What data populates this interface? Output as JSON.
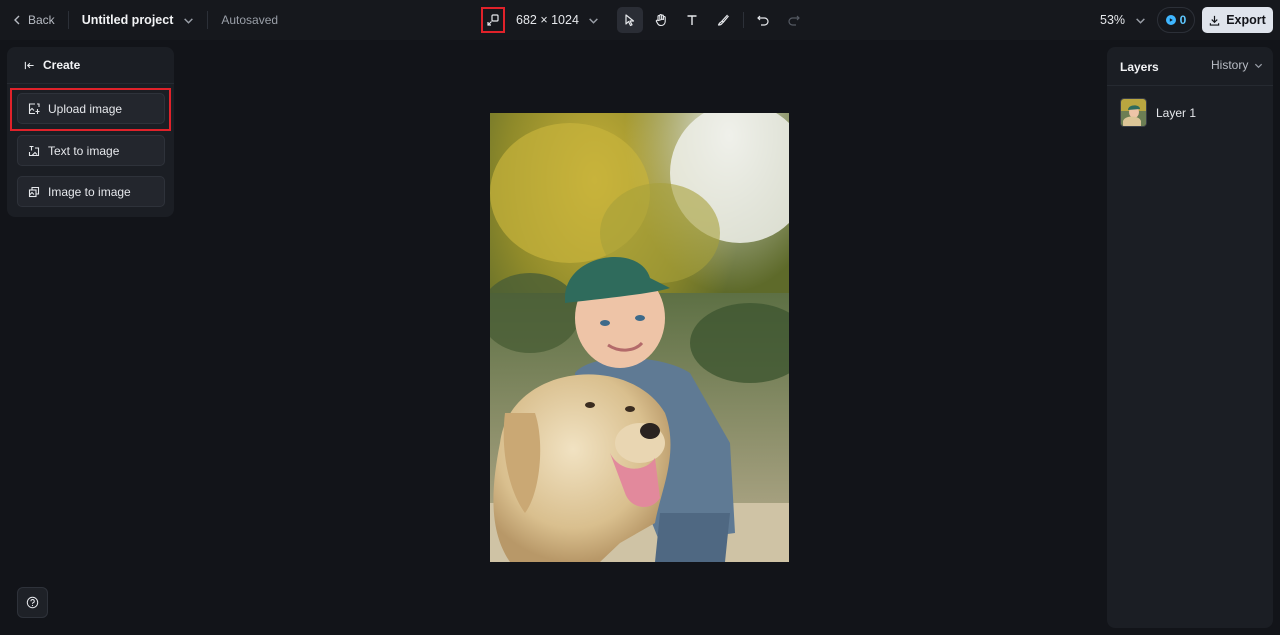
{
  "topbar": {
    "back_label": "Back",
    "project_name": "Untitled project",
    "autosave_status": "Autosaved",
    "canvas_size": "682 × 1024",
    "zoom": "53%",
    "credits": "0",
    "export_label": "Export"
  },
  "create_panel": {
    "title": "Create",
    "options": [
      {
        "label": "Upload image",
        "icon": "upload-image-icon"
      },
      {
        "label": "Text to image",
        "icon": "text-to-image-icon"
      },
      {
        "label": "Image to image",
        "icon": "image-to-image-icon"
      }
    ]
  },
  "layers_panel": {
    "title": "Layers",
    "history_label": "History",
    "layers": [
      {
        "name": "Layer 1"
      }
    ]
  },
  "colors": {
    "accent": "#3fb6ff",
    "highlight": "#e0222a",
    "background": "#121419",
    "panel": "#1b1e24"
  },
  "canvas_image": {
    "description_icon": "photo-image"
  }
}
